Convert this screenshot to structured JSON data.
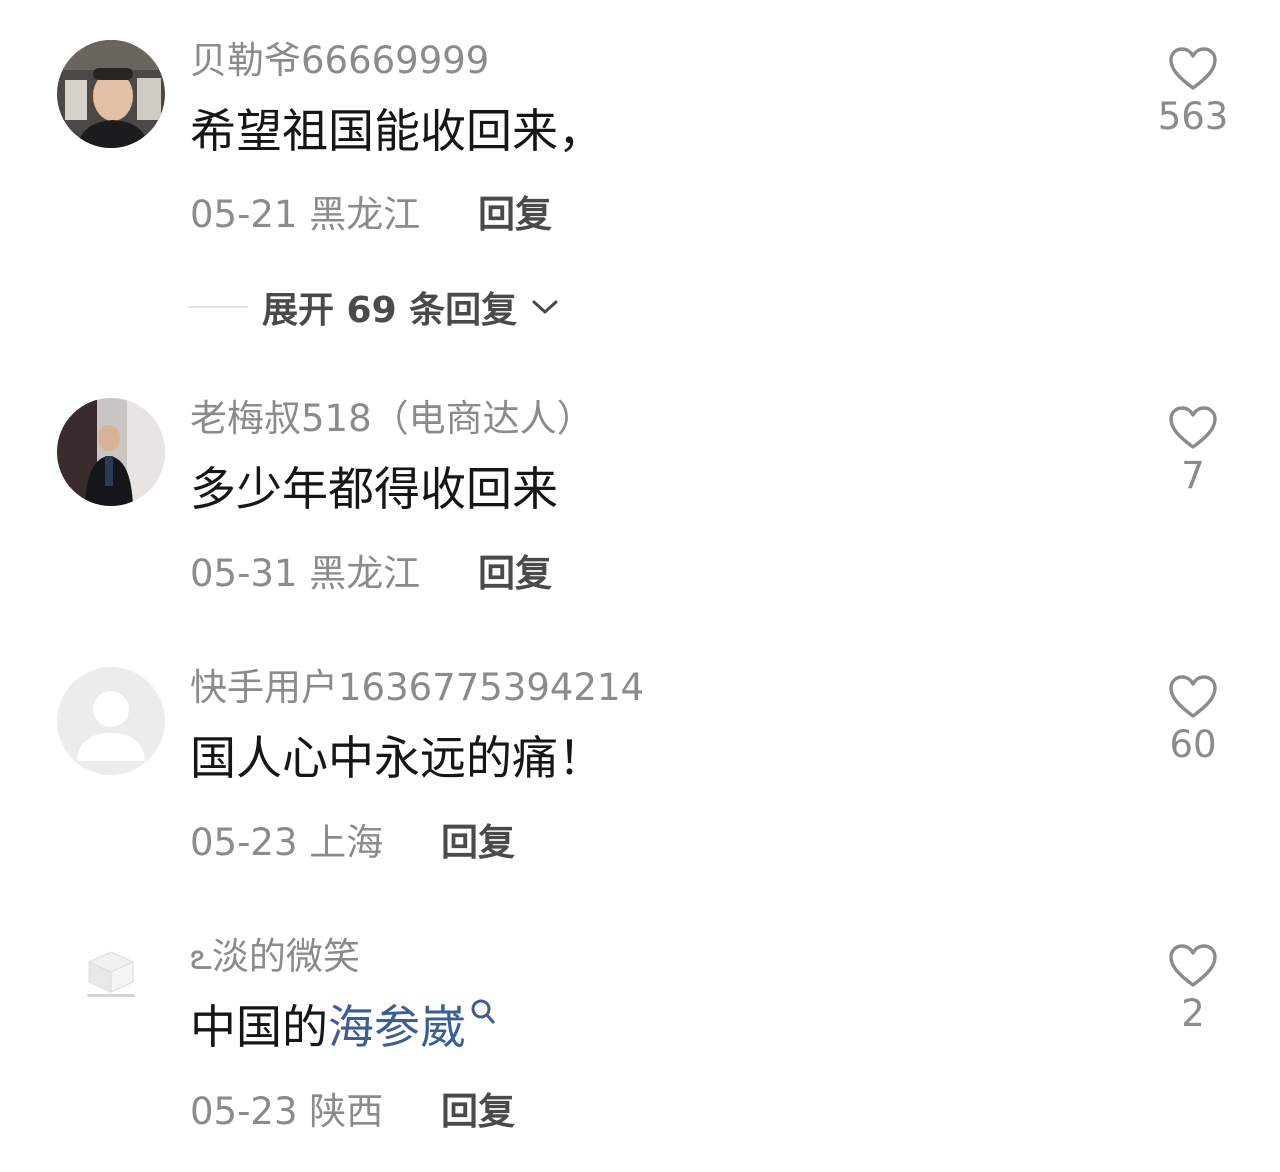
{
  "comments": [
    {
      "username": "贝勒爷66669999",
      "text": "希望祖国能收回来，",
      "date": "05-21",
      "location": "黑龙江",
      "reply_label": "回复",
      "likes": "563",
      "expand_label": "展开 69 条回复"
    },
    {
      "username": "老梅叔518（电商达人）",
      "text": "多少年都得收回来",
      "date": "05-31",
      "location": "黑龙江",
      "reply_label": "回复",
      "likes": "7"
    },
    {
      "username": "快手用户1636775394214",
      "text": "国人心中永远的痛！",
      "date": "05-23",
      "location": "上海",
      "reply_label": "回复",
      "likes": "60"
    },
    {
      "username_prefix": "ఽ",
      "username": "淡的微笑",
      "text_plain": "中国的",
      "text_link": "海参崴",
      "date": "05-23",
      "location": "陕西",
      "reply_label": "回复",
      "likes": "2"
    }
  ],
  "colors": {
    "secondary_text": "#8b8b8b",
    "primary_text": "#161616",
    "link": "#3b5f95",
    "reply": "#4a4a4a"
  }
}
